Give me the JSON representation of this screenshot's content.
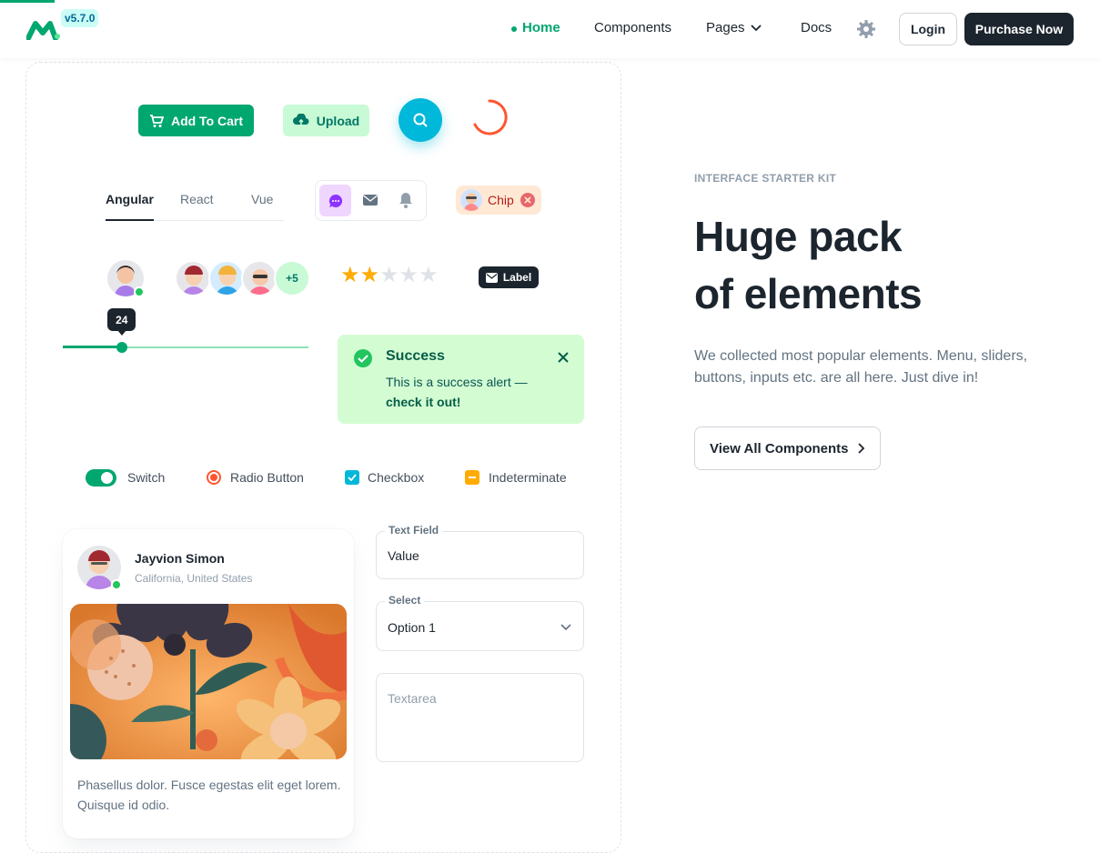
{
  "header": {
    "version": "v5.7.0",
    "nav": [
      "Home",
      "Components",
      "Pages",
      "Docs"
    ],
    "login": "Login",
    "purchase": "Purchase Now"
  },
  "buttons": {
    "add_to_cart": "Add To Cart",
    "upload": "Upload"
  },
  "tabs": [
    "Angular",
    "React",
    "Vue"
  ],
  "chip": "Chip",
  "badge_more": "+5",
  "rating": 2,
  "rating_max": 5,
  "label_tag": "Label",
  "slider": {
    "value": "24",
    "fraction": 0.24
  },
  "alert": {
    "title": "Success",
    "text": "This is a success alert —",
    "bold": "check it out!"
  },
  "controls": {
    "switch": "Switch",
    "radio": "Radio Button",
    "checkbox": "Checkbox",
    "indeterminate": "Indeterminate"
  },
  "card": {
    "name": "Jayvion Simon",
    "location": "California, United States",
    "text": "Phasellus dolor. Fusce egestas elit eget lorem. Quisque id odio."
  },
  "form": {
    "text_field_label": "Text Field",
    "text_field_value": "Value",
    "select_label": "Select",
    "select_value": "Option 1",
    "textarea_placeholder": "Textarea"
  },
  "hero": {
    "overline": "INTERFACE STARTER KIT",
    "title_line1": "Huge pack",
    "title_line2": "of elements",
    "desc": "We collected most popular elements. Menu, sliders, buttons, inputs etc. are all here. Just dive in!",
    "cta": "View All Components"
  },
  "colors": {
    "primary": "#00a76f",
    "dark": "#1c252e",
    "info": "#00b8d9",
    "warning": "#ffab00",
    "error": "#ff5630"
  }
}
